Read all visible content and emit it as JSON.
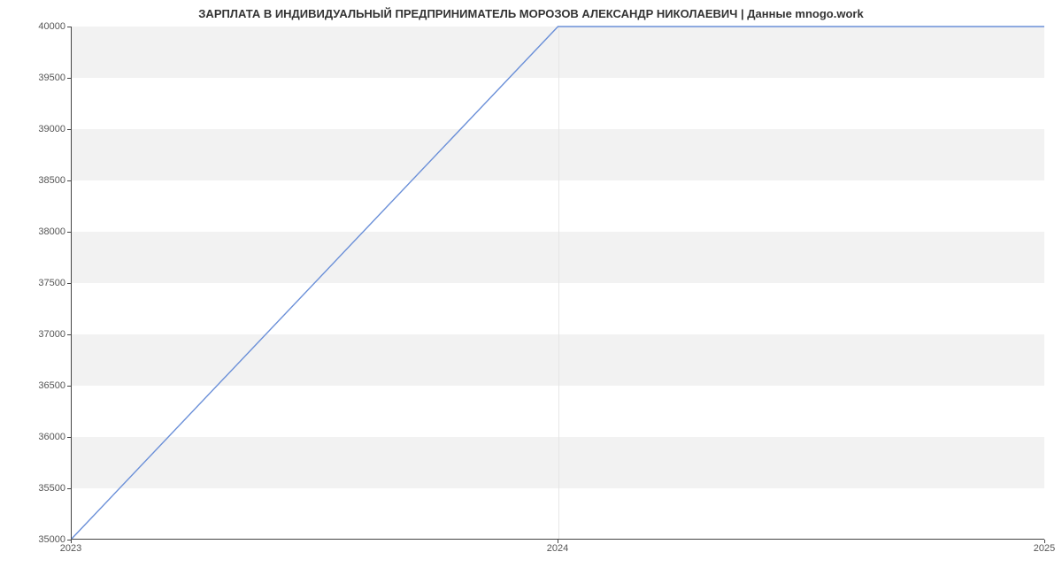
{
  "chart_data": {
    "type": "line",
    "title": "ЗАРПЛАТА В ИНДИВИДУАЛЬНЫЙ ПРЕДПРИНИМАТЕЛЬ МОРОЗОВ АЛЕКСАНДР НИКОЛАЕВИЧ | Данные mnogo.work",
    "xlabel": "",
    "ylabel": "",
    "x": [
      2023,
      2024,
      2025
    ],
    "values": [
      35000,
      40000,
      40000
    ],
    "x_ticks": [
      2023,
      2024,
      2025
    ],
    "y_ticks": [
      35000,
      35500,
      36000,
      36500,
      37000,
      37500,
      38000,
      38500,
      39000,
      39500,
      40000
    ],
    "xlim": [
      2023,
      2025
    ],
    "ylim": [
      35000,
      40000
    ],
    "grid": {
      "x": true,
      "y_bands": true
    },
    "colors": {
      "line": "#6a8fd8",
      "band": "#f2f2f2"
    }
  }
}
